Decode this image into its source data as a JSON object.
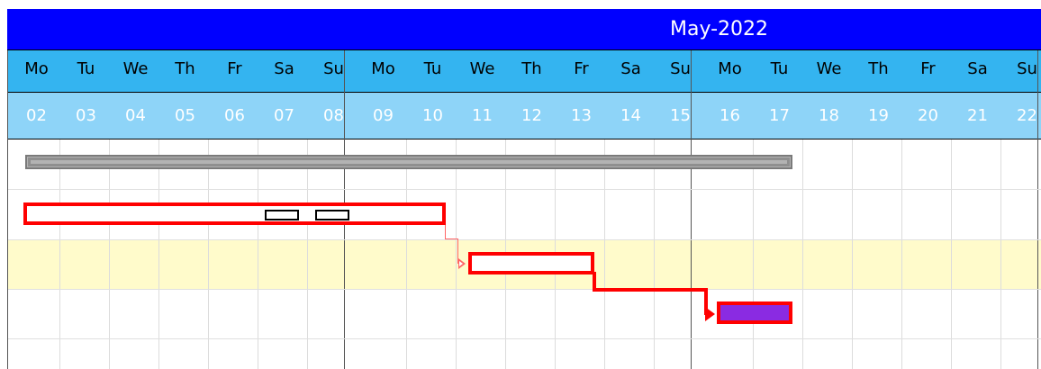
{
  "timeline": {
    "month": "May-2022",
    "days": [
      {
        "dow": "Mo",
        "date": "02"
      },
      {
        "dow": "Tu",
        "date": "03"
      },
      {
        "dow": "We",
        "date": "04"
      },
      {
        "dow": "Th",
        "date": "05"
      },
      {
        "dow": "Fr",
        "date": "06"
      },
      {
        "dow": "Sa",
        "date": "07"
      },
      {
        "dow": "Su",
        "date": "08"
      },
      {
        "dow": "Mo",
        "date": "09"
      },
      {
        "dow": "Tu",
        "date": "10"
      },
      {
        "dow": "We",
        "date": "11"
      },
      {
        "dow": "Th",
        "date": "12"
      },
      {
        "dow": "Fr",
        "date": "13"
      },
      {
        "dow": "Sa",
        "date": "14"
      },
      {
        "dow": "Su",
        "date": "15"
      },
      {
        "dow": "Mo",
        "date": "16"
      },
      {
        "dow": "Tu",
        "date": "17"
      },
      {
        "dow": "We",
        "date": "18"
      },
      {
        "dow": "Th",
        "date": "19"
      },
      {
        "dow": "Fr",
        "date": "20"
      },
      {
        "dow": "Sa",
        "date": "21"
      },
      {
        "dow": "Su",
        "date": "22"
      }
    ]
  },
  "colors": {
    "month_band": "#0000ff",
    "dow_band": "#34b4f0",
    "date_band": "#8ed4f8",
    "task_border": "#ff0000",
    "summary_bar": "#b3b3b3",
    "final_task_fill": "#8a2be2",
    "selected_row": "#fffbcb"
  }
}
